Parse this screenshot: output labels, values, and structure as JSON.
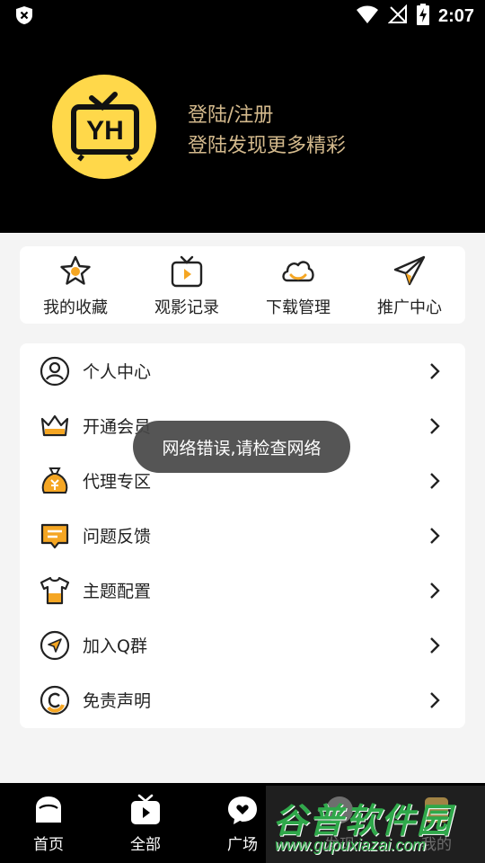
{
  "status_bar": {
    "time": "2:07",
    "icons": [
      "shield-icon",
      "wifi-icon",
      "no-signal-icon",
      "battery-charging-icon"
    ]
  },
  "header": {
    "logo_text": "YH",
    "login_title": "登陆/注册",
    "login_subtitle": "登陆发现更多精彩"
  },
  "quick_actions": [
    {
      "label": "我的收藏",
      "icon": "star-icon"
    },
    {
      "label": "观影记录",
      "icon": "tv-play-icon"
    },
    {
      "label": "下载管理",
      "icon": "cloud-icon"
    },
    {
      "label": "推广中心",
      "icon": "paper-plane-icon"
    }
  ],
  "menu": [
    {
      "label": "个人中心",
      "icon": "user-icon"
    },
    {
      "label": "开通会员",
      "icon": "crown-icon"
    },
    {
      "label": "代理专区",
      "icon": "money-bag-icon"
    },
    {
      "label": "问题反馈",
      "icon": "message-icon"
    },
    {
      "label": "主题配置",
      "icon": "tshirt-icon"
    },
    {
      "label": "加入Q群",
      "icon": "navigation-icon"
    },
    {
      "label": "免责声明",
      "icon": "copyright-icon"
    }
  ],
  "toast": "网络错误,请检查网络",
  "bottom_nav": [
    {
      "label": "首页",
      "icon": "home-icon"
    },
    {
      "label": "全部",
      "icon": "tv-icon"
    },
    {
      "label": "广场",
      "icon": "chat-heart-icon"
    },
    {
      "label": "发现",
      "icon": "discover-icon"
    },
    {
      "label": "我的",
      "icon": "profile-icon"
    }
  ],
  "watermark": {
    "text": "谷普软件园",
    "url": "www.gupuxiazai.com"
  },
  "colors": {
    "accent": "#f5a623",
    "logo_bg": "#ffd84a",
    "login_text": "#d3b98c"
  }
}
